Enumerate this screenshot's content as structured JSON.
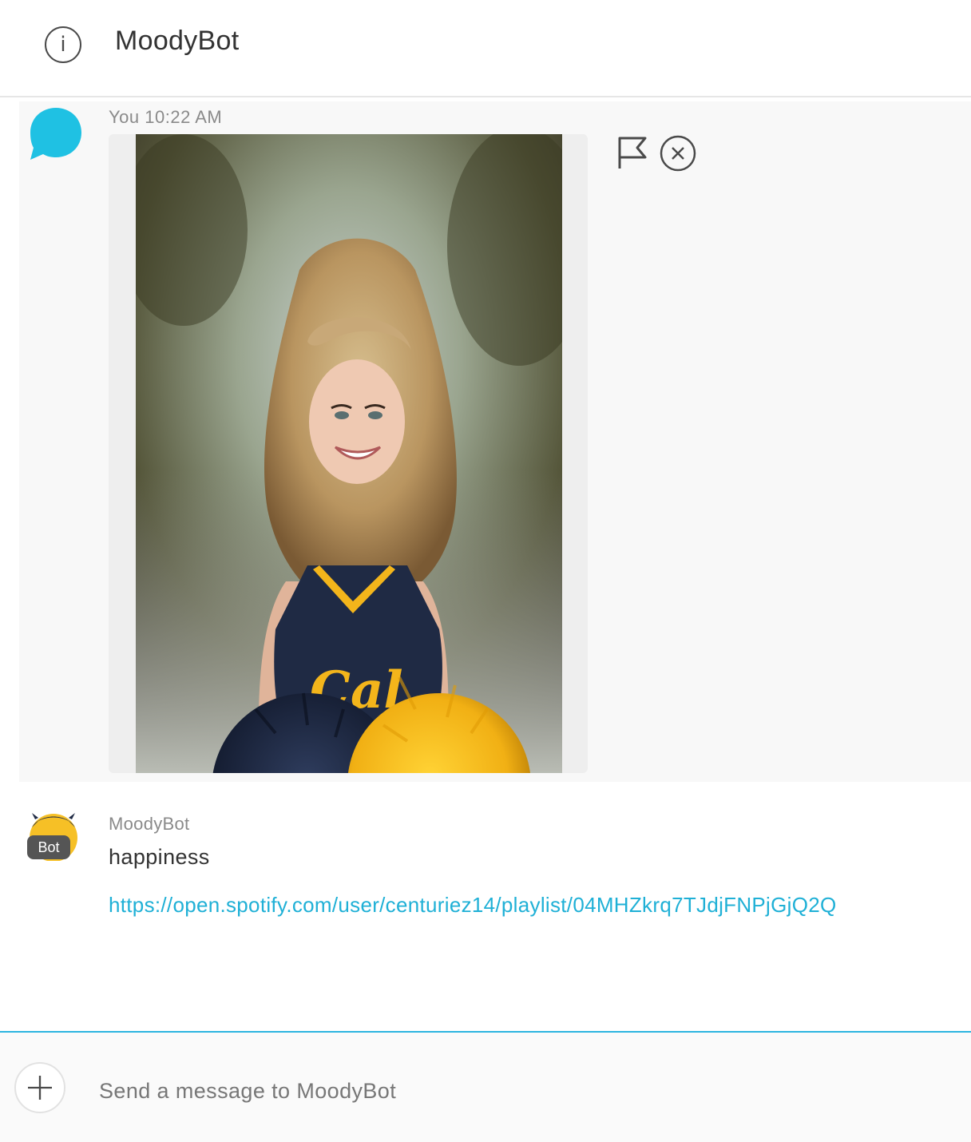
{
  "header": {
    "title": "MoodyBot",
    "info_icon": "info-icon",
    "info_glyph": "i"
  },
  "messages": [
    {
      "sender": "You",
      "time": "10:22 AM",
      "avatar_icon": "chat-bubble-icon",
      "attachment": {
        "type": "image",
        "subject": "smiling cheerleader in navy 'Cal' uniform holding navy and gold pom-poms"
      },
      "actions": [
        {
          "icon": "flag-icon"
        },
        {
          "icon": "close-circle-icon"
        }
      ]
    },
    {
      "sender": "MoodyBot",
      "badge": "Bot",
      "text": "happiness",
      "link": "https://open.spotify.com/user/centuriez14/playlist/04MHZkrq7TJdjFNPjGjQ2Q"
    }
  ],
  "composer": {
    "placeholder": "Send a message to MoodyBot",
    "value": "",
    "add_icon": "plus-icon"
  },
  "colors": {
    "accent": "#2bb5e0",
    "link": "#1fb0d6",
    "user_avatar": "#1fc1e3",
    "bot_avatar": "#f6c026",
    "navy": "#1f2a44",
    "gold": "#f3b51b"
  }
}
